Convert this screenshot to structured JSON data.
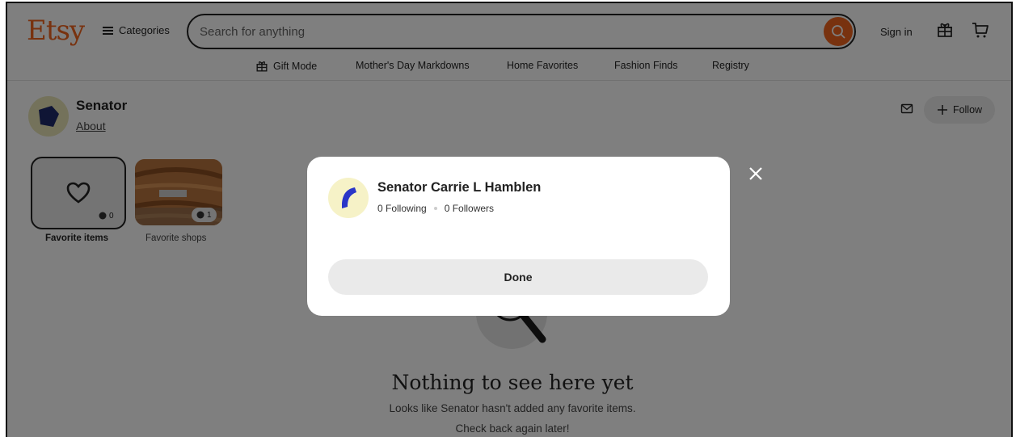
{
  "header": {
    "logo": "Etsy",
    "categories_label": "Categories",
    "search_placeholder": "Search for anything",
    "signin_label": "Sign in"
  },
  "nav": {
    "items": [
      "Gift Mode",
      "Mother's Day Markdowns",
      "Home Favorites",
      "Fashion Finds",
      "Registry"
    ]
  },
  "profile": {
    "name": "Senator",
    "about_label": "About",
    "follow_label": "Follow"
  },
  "tiles": {
    "favorite_items": {
      "label": "Favorite items",
      "count": "0"
    },
    "favorite_shops": {
      "label": "Favorite shops",
      "count": "1"
    }
  },
  "empty_state": {
    "title": "Nothing to see here yet",
    "line1": "Looks like Senator hasn't added any favorite items.",
    "line2": "Check back again later!"
  },
  "modal": {
    "name": "Senator Carrie L Hamblen",
    "following": "0 Following",
    "followers": "0 Followers",
    "done_label": "Done"
  },
  "colors": {
    "brand": "#f1641e",
    "avatar_bg": "#f6f2c7",
    "avatar_mark": "#2a36c8",
    "profile_mark": "#1f2a6b"
  },
  "icons": [
    "hamburger-icon",
    "search-icon",
    "gift-icon",
    "cart-icon",
    "message-icon",
    "plus-icon",
    "heart-icon",
    "globe-icon",
    "close-icon"
  ]
}
